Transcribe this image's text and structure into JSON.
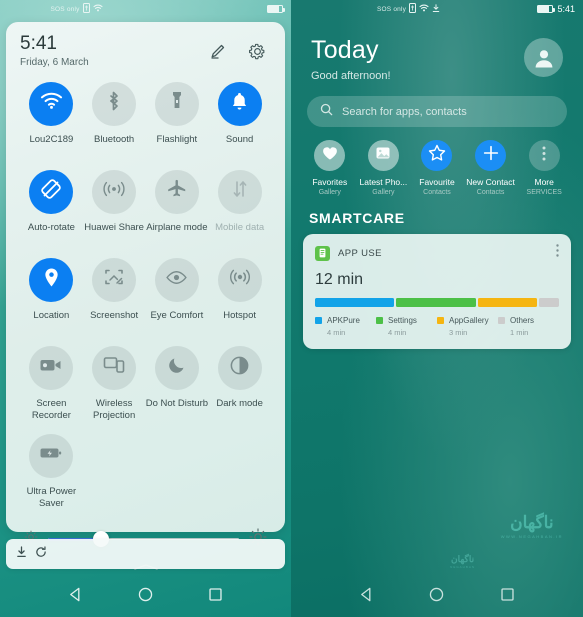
{
  "left": {
    "statusbar": {
      "carrier": "SOS only",
      "icons": [
        "sim-icon",
        "wifi-icon"
      ],
      "battery": "battery-icon"
    },
    "quick_settings": {
      "time": "5:41",
      "date": "Friday, 6 March",
      "edit_icon": "pencil-icon",
      "settings_icon": "gear-icon",
      "tiles": [
        {
          "label": "Lou2C189",
          "icon": "wifi-icon",
          "active": true
        },
        {
          "label": "Bluetooth",
          "icon": "bluetooth-icon",
          "active": false
        },
        {
          "label": "Flashlight",
          "icon": "flashlight-icon",
          "active": false
        },
        {
          "label": "Sound",
          "icon": "bell-icon",
          "active": true
        },
        {
          "label": "Auto-rotate",
          "icon": "auto-rotate-icon",
          "active": true
        },
        {
          "label": "Huawei Share",
          "icon": "huawei-share-icon",
          "active": false
        },
        {
          "label": "Airplane mode",
          "icon": "airplane-icon",
          "active": false
        },
        {
          "label": "Mobile data",
          "icon": "mobile-data-icon",
          "active": false,
          "disabled": true
        },
        {
          "label": "Location",
          "icon": "location-pin-icon",
          "active": true
        },
        {
          "label": "Screenshot",
          "icon": "screenshot-icon",
          "active": false
        },
        {
          "label": "Eye Comfort",
          "icon": "eye-icon",
          "active": false
        },
        {
          "label": "Hotspot",
          "icon": "hotspot-icon",
          "active": false
        },
        {
          "label": "Screen Recorder",
          "icon": "video-camera-icon",
          "active": false
        },
        {
          "label": "Wireless Projection",
          "icon": "wireless-projection-icon",
          "active": false
        },
        {
          "label": "Do Not Disturb",
          "icon": "moon-icon",
          "active": false
        },
        {
          "label": "Dark mode",
          "icon": "dark-mode-icon",
          "active": false
        },
        {
          "label": "Ultra Power Saver",
          "icon": "battery-saver-icon",
          "active": false
        }
      ],
      "brightness": {
        "value_percent": 28,
        "low_icon": "sun-small-icon",
        "high_icon": "sun-large-icon"
      },
      "handle_icon": "collapse-handle-icon"
    },
    "notification_card": {
      "icons": [
        "download-icon",
        "refresh-icon"
      ]
    },
    "navbar": {
      "back": "back-triangle-icon",
      "home": "home-circle-icon",
      "recents": "recents-square-icon"
    }
  },
  "right": {
    "statusbar": {
      "carrier": "SOS only",
      "icons": [
        "sim-icon",
        "wifi-icon",
        "download-icon"
      ],
      "time": "5:41",
      "battery": "battery-icon"
    },
    "header": {
      "title": "Today",
      "greeting": "Good afternoon!",
      "avatar": "avatar-icon"
    },
    "search": {
      "placeholder": "Search for apps, contacts",
      "icon": "search-icon"
    },
    "shortcuts": [
      {
        "label": "Favorites",
        "sublabel": "Gallery",
        "icon": "heart-icon",
        "style": "pale"
      },
      {
        "label": "Latest Pho...",
        "sublabel": "Gallery",
        "icon": "image-icon",
        "style": "pale"
      },
      {
        "label": "Favourite",
        "sublabel": "Contacts",
        "icon": "star-icon",
        "style": "blue"
      },
      {
        "label": "New Contact",
        "sublabel": "Contacts",
        "icon": "plus-icon",
        "style": "blue"
      },
      {
        "label": "More",
        "sublabel": "SERVICES",
        "icon": "more-vertical-icon",
        "style": "grey"
      }
    ],
    "section_title": "SMARTCARE",
    "app_use_card": {
      "icon": "app-use-icon",
      "title": "APP USE",
      "menu_icon": "more-vertical-icon",
      "total": "12 min"
    },
    "watermark": {
      "main": "ناگهان",
      "sub": "WWW.NEGAHBAN.IR"
    },
    "watermark2": {
      "main": "ناگهان",
      "sub": "NEGAHBAN"
    },
    "navbar": {
      "back": "back-triangle-icon",
      "home": "home-circle-icon",
      "recents": "recents-square-icon"
    }
  },
  "chart_data": {
    "type": "bar",
    "title": "APP USE",
    "subtitle": "12 min",
    "orientation": "stacked-horizontal",
    "categories": [
      "APKPure",
      "Settings",
      "AppGallery",
      "Others"
    ],
    "values": [
      4,
      4,
      3,
      1
    ],
    "value_labels": [
      "4 min",
      "4 min",
      "3 min",
      "1 min"
    ],
    "colors": [
      "#12a3e8",
      "#4cc047",
      "#f5b511",
      "#cccccc"
    ],
    "unit": "min",
    "total": 12,
    "xlabel": "",
    "ylabel": "",
    "legend_position": "bottom",
    "grid": false
  }
}
